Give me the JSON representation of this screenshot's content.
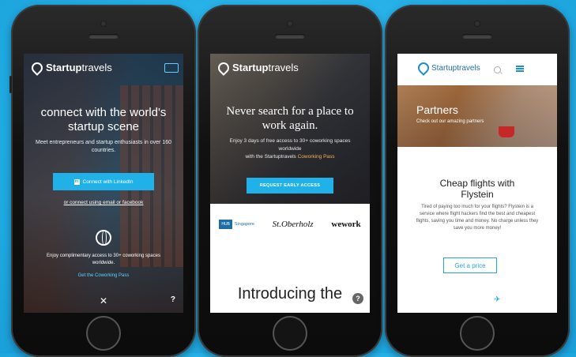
{
  "phone1": {
    "brand_prefix": "Startup",
    "brand_suffix": "travels",
    "headline_line1": "connect with the world's",
    "headline_line2": "startup scene",
    "subtitle": "Meet entrepreneurs and startup enthusiasts in over 160 countries.",
    "linkedin_button": "Connect with LinkedIn",
    "linkedin_glyph": "in",
    "alt_link": "or connect using email or facebook",
    "perk_text": "Enjoy complimentary access to 30+ coworking spaces worldwide.",
    "cowork_link": "Get the Coworking Pass",
    "help_glyph": "?"
  },
  "phone2": {
    "brand_prefix": "Startup",
    "brand_suffix": "travels",
    "headline_line1": "Never search for a place to",
    "headline_line2": "work again.",
    "subtitle_main": "Enjoy 3 days of free access to 30+ coworking spaces worldwide",
    "subtitle_with": "with the Startuptravels",
    "subtitle_highlight": "Coworking Pass",
    "cta_button": "REQUEST EARLY ACCESS",
    "partner_hub_box": "HUB",
    "partner_hub_text": "Singapore",
    "partner_script": "St.Oberholz",
    "partner_wework": "wework",
    "intro_heading": "Introducing the",
    "help_glyph": "?"
  },
  "phone3": {
    "brand": "Startuptravels",
    "hero_title": "Partners",
    "hero_subtitle": "Check out our amazing partners",
    "section_title_line1": "Cheap flights with",
    "section_title_line2": "Flystein",
    "body_text": "Tired of paying too much for your flights? Flystein is a service where flight hackers find the best and cheapest flights, saving you time and money. No charge unless they save you more money!",
    "cta_button": "Get a price",
    "plane_glyph": "✈"
  },
  "colors": {
    "background": "#22aee6",
    "accent": "#20b1e8",
    "highlight": "#f3b15a"
  }
}
